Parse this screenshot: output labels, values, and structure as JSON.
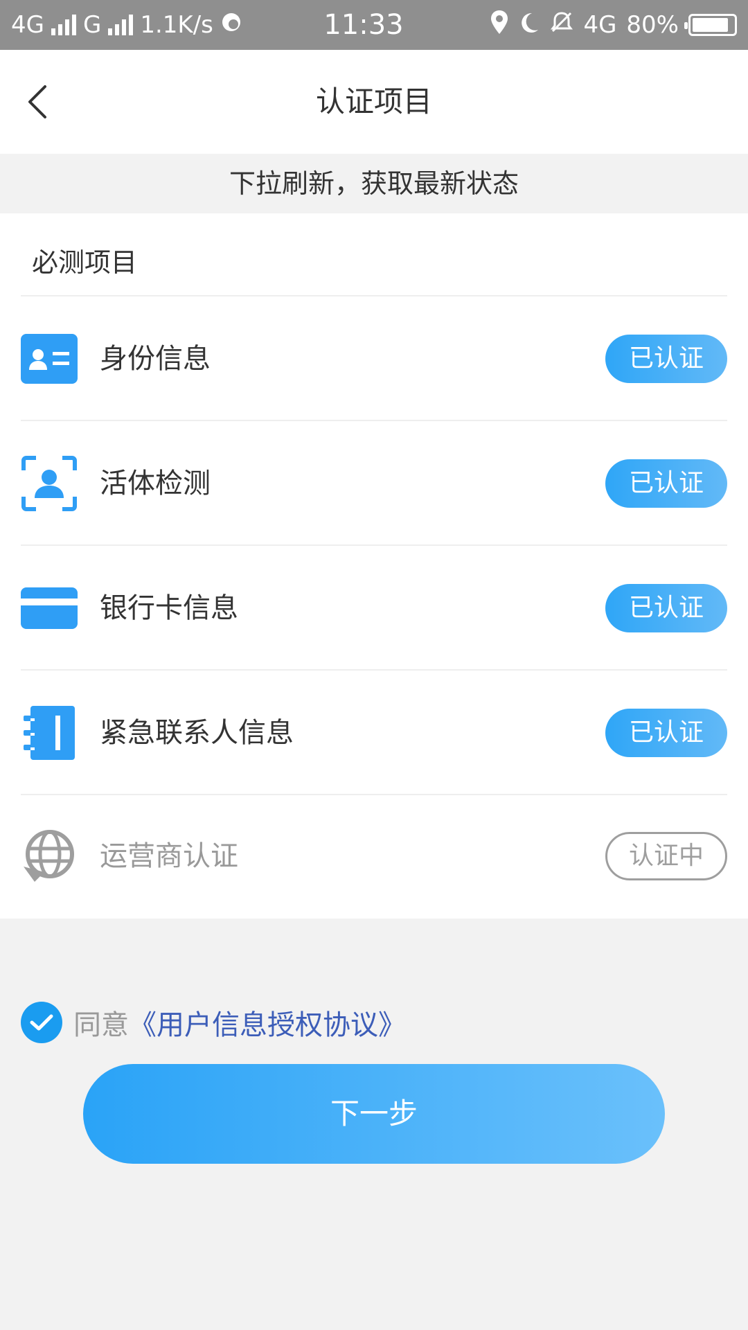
{
  "status_bar": {
    "network1": "4G",
    "network2": "G",
    "speed": "1.1K/s",
    "time": "11:33",
    "network3": "4G",
    "battery": "80%",
    "icons": [
      "signal-icon",
      "data-saver-icon",
      "location-icon",
      "moon-icon",
      "mute-bell-icon",
      "battery-icon"
    ]
  },
  "nav": {
    "title": "认证项目",
    "back_icon": "chevron-left-icon"
  },
  "refresh_hint": "下拉刷新，获取最新状态",
  "section": {
    "title": "必测项目",
    "items": [
      {
        "label": "身份信息",
        "status": "已认证",
        "icon": "id-card-icon",
        "state": "verified"
      },
      {
        "label": "活体检测",
        "status": "已认证",
        "icon": "face-scan-icon",
        "state": "verified"
      },
      {
        "label": "银行卡信息",
        "status": "已认证",
        "icon": "bank-card-icon",
        "state": "verified"
      },
      {
        "label": "紧急联系人信息",
        "status": "已认证",
        "icon": "contact-book-icon",
        "state": "verified"
      },
      {
        "label": "运营商认证",
        "status": "认证中",
        "icon": "globe-refresh-icon",
        "state": "pending"
      }
    ]
  },
  "agreement": {
    "prefix": "同意",
    "link": "《用户信息授权协议》",
    "checked": true
  },
  "next_button": "下一步",
  "colors": {
    "accent": "#1a9cf0",
    "badge_start": "#2fa6f7",
    "badge_end": "#62b9f7",
    "link": "#3c5db8",
    "pending_gray": "#9e9e9e",
    "text": "#333333",
    "muted_text": "#999999"
  }
}
